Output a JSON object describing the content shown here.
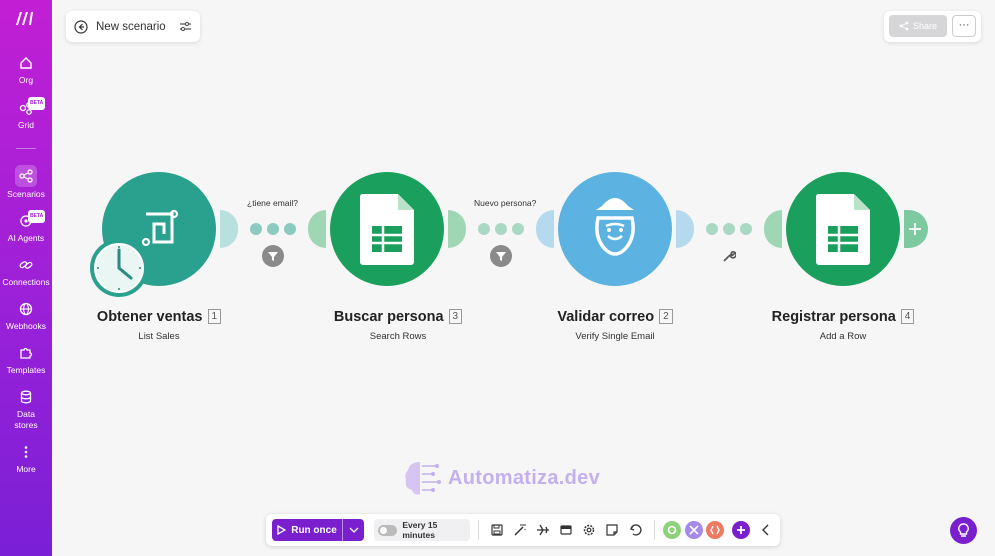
{
  "sidebar": {
    "items": [
      {
        "label": "Org",
        "icon": "home-icon"
      },
      {
        "label": "Grid",
        "icon": "grid-icon",
        "badge": "BETA"
      },
      {
        "label": "Scenarios",
        "icon": "share-nodes-icon",
        "active": true
      },
      {
        "label": "AI Agents",
        "icon": "ai-agent-icon",
        "badge": "BETA"
      },
      {
        "label": "Connections",
        "icon": "link-icon"
      },
      {
        "label": "Webhooks",
        "icon": "globe-icon"
      },
      {
        "label": "Templates",
        "icon": "puzzle-icon"
      },
      {
        "label": "Data stores",
        "icon": "database-icon"
      },
      {
        "label": "More",
        "icon": "more-vertical-icon"
      }
    ]
  },
  "header": {
    "scenario_title": "New scenario",
    "share_label": "Share",
    "more_label": "···"
  },
  "modules": [
    {
      "name": "Obtener ventas",
      "number": "1",
      "action": "List Sales",
      "color": "#2aa08f"
    },
    {
      "name": "Buscar persona",
      "number": "3",
      "action": "Search Rows",
      "color": "#1aa05c"
    },
    {
      "name": "Validar correo",
      "number": "2",
      "action": "Verify Single Email",
      "color": "#5cb3e2"
    },
    {
      "name": "Registrar persona",
      "number": "4",
      "action": "Add a Row",
      "color": "#1aa05c"
    }
  ],
  "routes": [
    {
      "label": "¿tiene email?"
    },
    {
      "label": "Nuevo persona?"
    }
  ],
  "watermark": {
    "text": "Automatiza.dev"
  },
  "toolbar": {
    "run_label": "Run once",
    "schedule_label": "Every 15 minutes"
  },
  "colors": {
    "brand": "#7a1fcd",
    "sidebar_top": "#c21fd4",
    "sheets_green": "#1aa05c",
    "teal": "#2aa08f",
    "blue": "#5cb3e2"
  }
}
